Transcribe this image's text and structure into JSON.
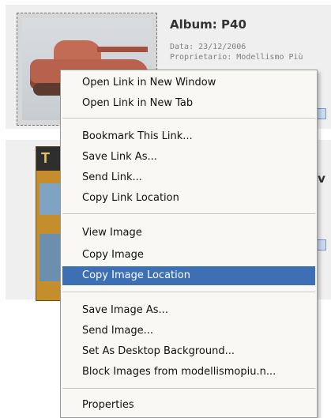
{
  "albums": [
    {
      "title": "Album: P40",
      "date": "Data: 23/12/2006",
      "owner": "Proprietario: Modellismo Più"
    },
    {
      "title_partial": "av",
      "cover_letters": "T"
    }
  ],
  "context_menu": {
    "items": [
      {
        "label": "Open Link in New Window"
      },
      {
        "label": "Open Link in New Tab"
      },
      {
        "label": "Bookmark This Link..."
      },
      {
        "label": "Save Link As..."
      },
      {
        "label": "Send Link..."
      },
      {
        "label": "Copy Link Location"
      },
      {
        "label": "View Image"
      },
      {
        "label": "Copy Image"
      },
      {
        "label": "Copy Image Location",
        "highlighted": true
      },
      {
        "label": "Save Image As..."
      },
      {
        "label": "Send Image..."
      },
      {
        "label": "Set As Desktop Background..."
      },
      {
        "label": "Block Images from modellismopiu.n..."
      },
      {
        "label": "Properties"
      }
    ]
  },
  "colors": {
    "menu_highlight": "#3d6fb4",
    "menu_background": "#f9f8f5",
    "card_background": "#efefef"
  }
}
